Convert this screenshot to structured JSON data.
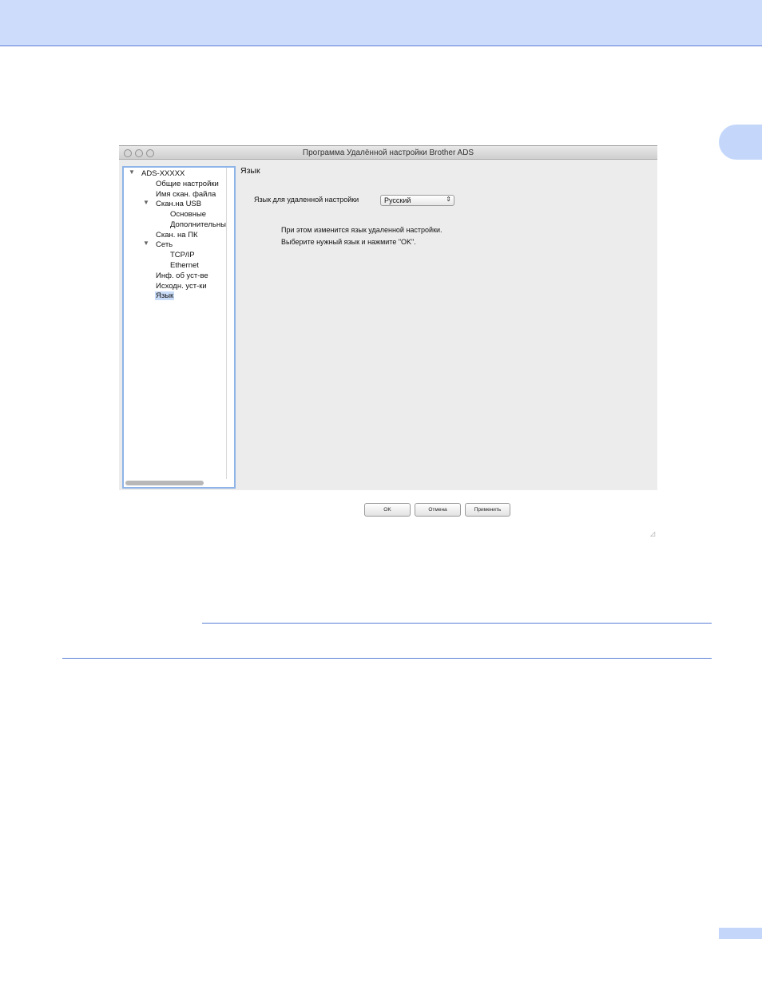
{
  "window": {
    "title": "Программа Удалённой настройки Brother ADS"
  },
  "tree": {
    "root": "ADS-XXXXX",
    "general": "Общие настройки",
    "scan_file_name": "Имя скан. файла",
    "scan_usb": "Скан.на USB",
    "basic": "Основные",
    "advanced": "Дополнительны",
    "scan_pc": "Скан. на ПК",
    "network": "Сеть",
    "tcpip": "TCP/IP",
    "ethernet": "Ethernet",
    "device_info": "Инф. об уст-ве",
    "reset": "Исходн. уст-ки",
    "language": "Язык"
  },
  "content": {
    "title": "Язык",
    "language_label": "Язык для удаленной настройки",
    "language_value": "Русский",
    "info_line1": "При этом изменится язык удаленной настройки.",
    "info_line2": "Выберите нужный язык и нажмите \"OK\"."
  },
  "buttons": {
    "ok": "OK",
    "cancel": "Отмена",
    "apply": "Применить"
  },
  "colors": {
    "header_bg": "#cddcfb",
    "accent_rule": "#5a7fd6",
    "tab_bg": "#c4d7fb",
    "selection": "#c9dcf7"
  }
}
